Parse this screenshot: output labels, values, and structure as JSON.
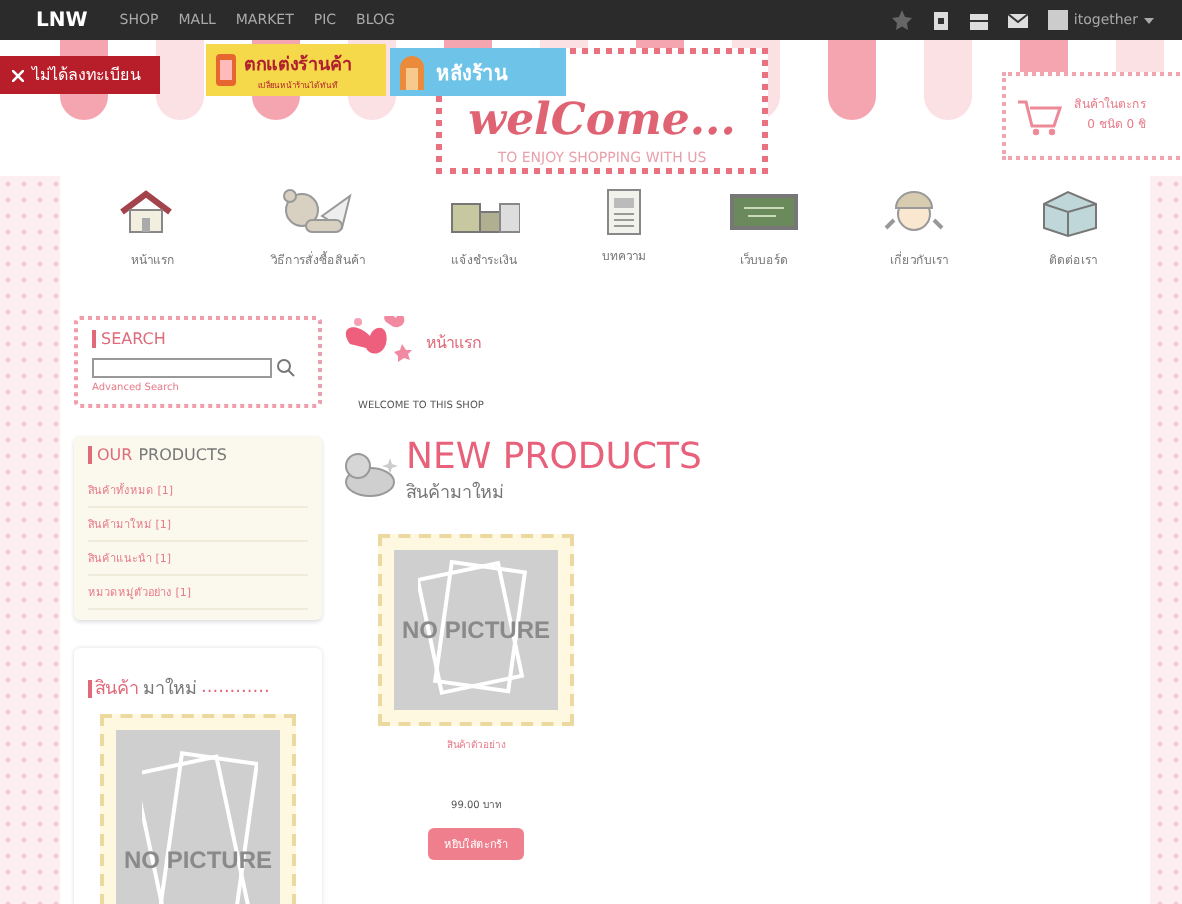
{
  "top_bar": {
    "logo": "LNW",
    "menu": [
      "SHOP",
      "MALL",
      "MARKET",
      "PIC",
      "BLOG"
    ],
    "user": "itogether"
  },
  "header": {
    "register_tab": "ไม่ได้ลงทะเบียน",
    "decorate_button": {
      "title": "ตกแต่งร้านค้า",
      "subtitle": "เปลี่ยนหน้าร้านได้ทันที"
    },
    "backstore_button": "หลังร้าน",
    "banner": {
      "title": "welCome...",
      "subtitle": "TO ENJOY SHOPPING WITH US"
    },
    "cart": {
      "label": "สินค้าในตะกร",
      "count": "0 ชนิด 0 ชิ"
    }
  },
  "nav": [
    "หน้าแรก",
    "วิธีการสั่งซื้อสินค้า",
    "แจ้งชำระเงิน",
    "บทความ",
    "เว็บบอร์ด",
    "เกี่ยวกับเรา",
    "ติดต่อเรา"
  ],
  "search": {
    "title": "SEARCH",
    "advanced": "Advanced Search"
  },
  "our_products": {
    "title_accent": "OUR",
    "title": "PRODUCTS",
    "items": [
      "สินค้าทั้งหมด [1]",
      "สินค้ามาใหม่ [1]",
      "สินค้าแนะนำ [1]",
      "หมวดหมู่ตัวอย่าง [1]"
    ]
  },
  "sidebar_new": {
    "title_accent": "สินค้า",
    "title": "มาใหม่",
    "dots": "............",
    "image_text": "NO PICTURE"
  },
  "breadcrumb": "หน้าแรก",
  "welcome_text": "WELCOME TO THIS SHOP",
  "new_products": {
    "title": "NEW PRODUCTS",
    "subtitle": "สินค้ามาใหม่",
    "items": [
      {
        "image_text": "NO PICTURE",
        "name": "สินค้าตัวอย่าง",
        "price": "99.00 บาท",
        "button": "หยิบใส่ตะกร้า"
      }
    ]
  }
}
